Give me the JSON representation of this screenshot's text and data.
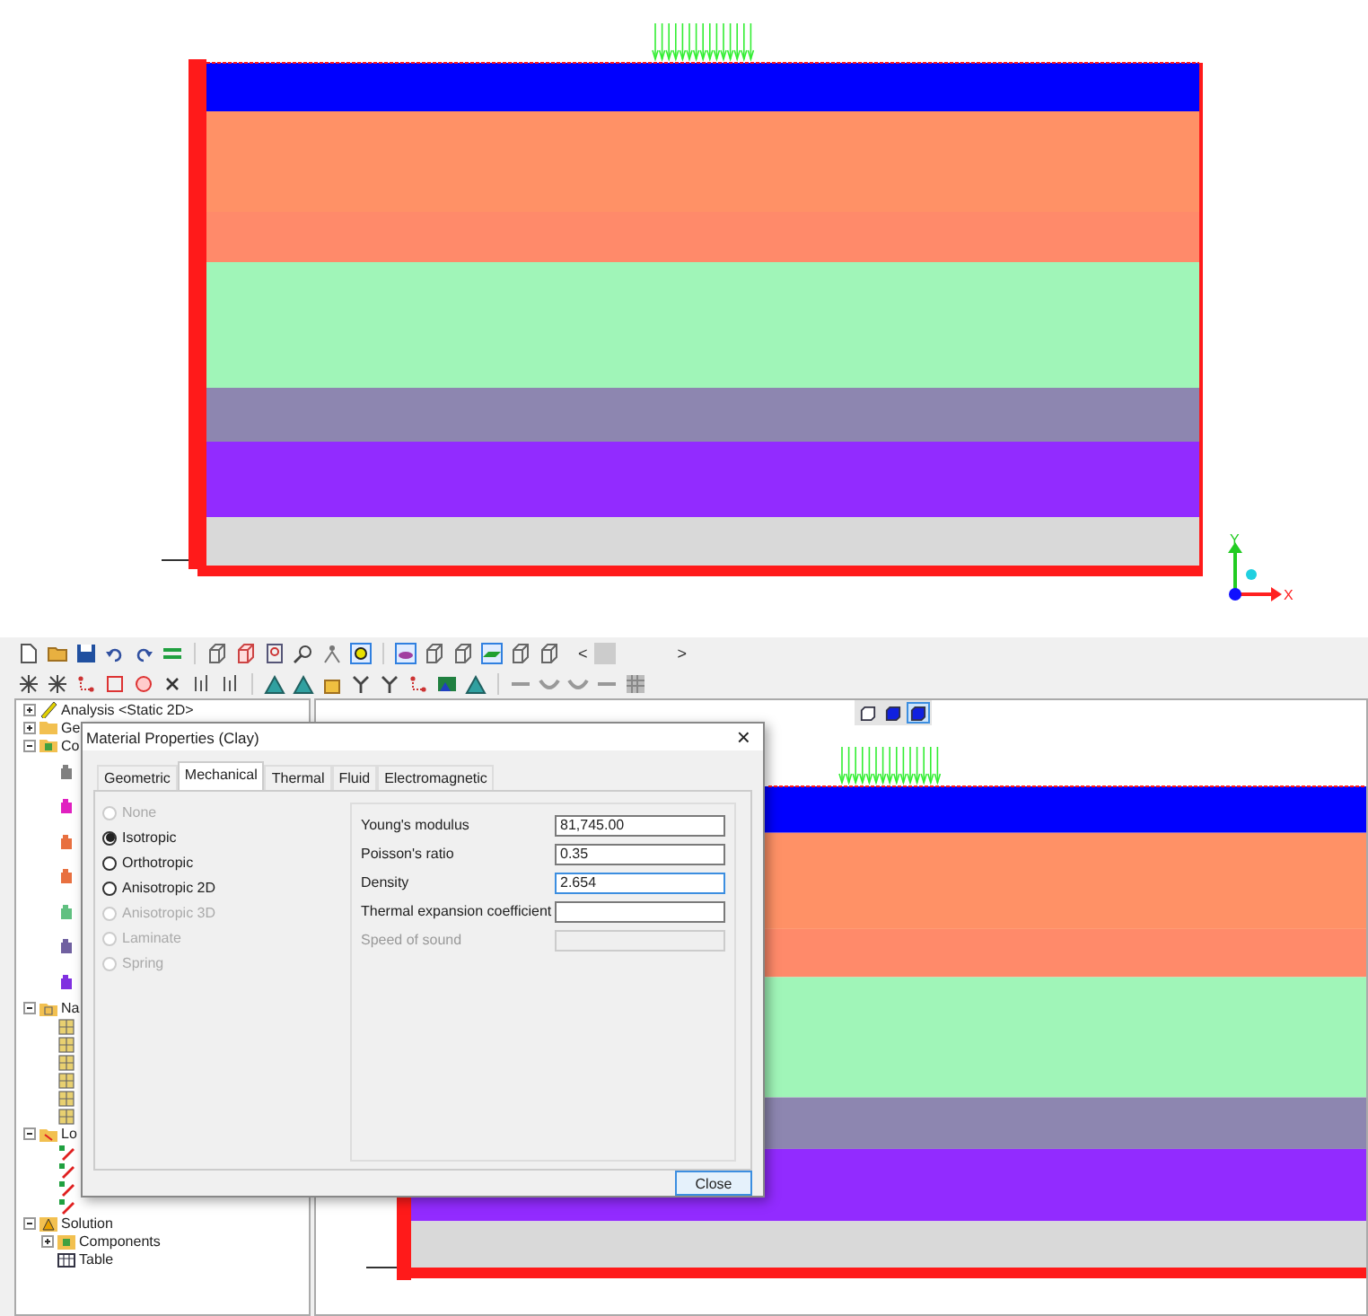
{
  "model": {
    "layers": [
      {
        "color": "#0000ff"
      },
      {
        "color": "#ff9166"
      },
      {
        "color": "#ff8a6a"
      },
      {
        "color": "#a0f5b8"
      },
      {
        "color": "#8d86b0"
      },
      {
        "color": "#922bff"
      },
      {
        "color": "#d9d9d9"
      }
    ],
    "axes": {
      "y_label": "Y",
      "x_label": "X"
    }
  },
  "toolbar": {
    "scroll_left": "<",
    "scroll_right": ">"
  },
  "tree": [
    {
      "label": "Analysis <Static 2D>",
      "kind": "analysis",
      "expanded": false
    },
    {
      "label": "Ge",
      "kind": "folder",
      "expanded": false
    },
    {
      "label": "Co",
      "kind": "materials",
      "expanded": true,
      "children": [
        {
          "kind": "material",
          "color": "#808080"
        },
        {
          "kind": "material",
          "color": "#e020c0"
        },
        {
          "kind": "material",
          "color": "#e87040"
        },
        {
          "kind": "material",
          "color": "#e87040"
        },
        {
          "kind": "material",
          "color": "#60c080"
        },
        {
          "kind": "material",
          "color": "#7060a0"
        },
        {
          "kind": "material",
          "color": "#8030e0"
        }
      ]
    },
    {
      "label": "Na",
      "kind": "mesh-folder",
      "expanded": true,
      "children": [
        {
          "kind": "mesh"
        },
        {
          "kind": "mesh"
        },
        {
          "kind": "mesh"
        },
        {
          "kind": "mesh"
        },
        {
          "kind": "mesh"
        },
        {
          "kind": "mesh"
        }
      ]
    },
    {
      "label": "Lo",
      "kind": "loads",
      "expanded": true,
      "children": [
        {
          "kind": "load"
        },
        {
          "kind": "load"
        },
        {
          "kind": "load"
        },
        {
          "kind": "load"
        }
      ]
    },
    {
      "label": "Solution",
      "kind": "solution",
      "expanded": true,
      "children": [
        {
          "label": "Components",
          "kind": "components",
          "expanded": false
        },
        {
          "label": "Table",
          "kind": "table"
        }
      ]
    }
  ],
  "view_buttons": [
    {
      "selected": false
    },
    {
      "selected": false
    },
    {
      "selected": true
    }
  ],
  "dialog": {
    "title": "Material Properties (Clay)",
    "close": "×",
    "tabs": [
      {
        "label": "Geometric",
        "selected": false
      },
      {
        "label": "Mechanical",
        "selected": true
      },
      {
        "label": "Thermal",
        "selected": false
      },
      {
        "label": "Fluid",
        "selected": false
      },
      {
        "label": "Electromagnetic",
        "selected": false
      }
    ],
    "options": [
      {
        "label": "None",
        "selected": false,
        "disabled": true
      },
      {
        "label": "Isotropic",
        "selected": true,
        "disabled": false
      },
      {
        "label": "Orthotropic",
        "selected": false,
        "disabled": false
      },
      {
        "label": "Anisotropic 2D",
        "selected": false,
        "disabled": false
      },
      {
        "label": "Anisotropic 3D",
        "selected": false,
        "disabled": true
      },
      {
        "label": "Laminate",
        "selected": false,
        "disabled": true
      },
      {
        "label": "Spring",
        "selected": false,
        "disabled": true
      }
    ],
    "properties": [
      {
        "label": "Young's modulus",
        "value": "81,745.00",
        "disabled": false,
        "focused": false
      },
      {
        "label": "Poisson's ratio",
        "value": "0.35",
        "disabled": false,
        "focused": false
      },
      {
        "label": "Density",
        "value": "2.654",
        "disabled": false,
        "focused": true
      },
      {
        "label": "Thermal expansion coefficient",
        "disabled": false,
        "focused": false
      },
      {
        "label": "Speed of sound",
        "disabled": true,
        "focused": false
      }
    ],
    "close_button": "Close"
  }
}
